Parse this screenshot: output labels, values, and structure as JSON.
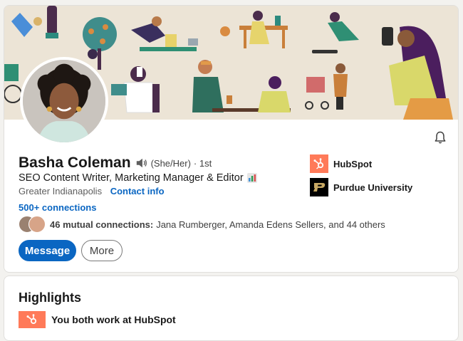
{
  "profile": {
    "name": "Basha Coleman",
    "pronouns": "(She/Her)",
    "degree": "· 1st",
    "headline": "SEO Content Writer, Marketing Manager & Editor",
    "location": "Greater Indianapolis",
    "contact_label": "Contact info",
    "connections": "500+ connections",
    "mutual_count": "46 mutual connections:",
    "mutual_names": "Jana Rumberger, Amanda Edens Sellers, and 44 others"
  },
  "actions": {
    "message_label": "Message",
    "more_label": "More"
  },
  "companies": [
    {
      "name": "HubSpot",
      "logo_color": "#ff7a59"
    },
    {
      "name": "Purdue University",
      "logo_color": "#000000"
    }
  ],
  "highlights": {
    "title": "Highlights",
    "item_text": "You both work at HubSpot"
  },
  "colors": {
    "brand_blue": "#0a66c2",
    "hubspot_orange": "#ff7a59",
    "banner_bg": "#ece4d6"
  },
  "icons": [
    "bell-icon",
    "speaker-icon",
    "bar-chart-icon",
    "hubspot-logo-icon",
    "purdue-logo-icon"
  ]
}
